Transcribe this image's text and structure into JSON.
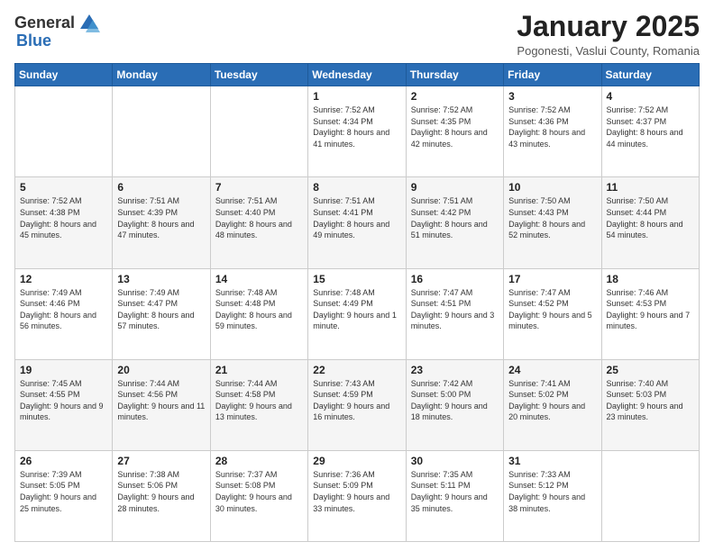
{
  "logo": {
    "general": "General",
    "blue": "Blue"
  },
  "header": {
    "title": "January 2025",
    "subtitle": "Pogonesti, Vaslui County, Romania"
  },
  "weekdays": [
    "Sunday",
    "Monday",
    "Tuesday",
    "Wednesday",
    "Thursday",
    "Friday",
    "Saturday"
  ],
  "weeks": [
    [
      {
        "day": "",
        "info": ""
      },
      {
        "day": "",
        "info": ""
      },
      {
        "day": "",
        "info": ""
      },
      {
        "day": "1",
        "info": "Sunrise: 7:52 AM\nSunset: 4:34 PM\nDaylight: 8 hours and 41 minutes."
      },
      {
        "day": "2",
        "info": "Sunrise: 7:52 AM\nSunset: 4:35 PM\nDaylight: 8 hours and 42 minutes."
      },
      {
        "day": "3",
        "info": "Sunrise: 7:52 AM\nSunset: 4:36 PM\nDaylight: 8 hours and 43 minutes."
      },
      {
        "day": "4",
        "info": "Sunrise: 7:52 AM\nSunset: 4:37 PM\nDaylight: 8 hours and 44 minutes."
      }
    ],
    [
      {
        "day": "5",
        "info": "Sunrise: 7:52 AM\nSunset: 4:38 PM\nDaylight: 8 hours and 45 minutes."
      },
      {
        "day": "6",
        "info": "Sunrise: 7:51 AM\nSunset: 4:39 PM\nDaylight: 8 hours and 47 minutes."
      },
      {
        "day": "7",
        "info": "Sunrise: 7:51 AM\nSunset: 4:40 PM\nDaylight: 8 hours and 48 minutes."
      },
      {
        "day": "8",
        "info": "Sunrise: 7:51 AM\nSunset: 4:41 PM\nDaylight: 8 hours and 49 minutes."
      },
      {
        "day": "9",
        "info": "Sunrise: 7:51 AM\nSunset: 4:42 PM\nDaylight: 8 hours and 51 minutes."
      },
      {
        "day": "10",
        "info": "Sunrise: 7:50 AM\nSunset: 4:43 PM\nDaylight: 8 hours and 52 minutes."
      },
      {
        "day": "11",
        "info": "Sunrise: 7:50 AM\nSunset: 4:44 PM\nDaylight: 8 hours and 54 minutes."
      }
    ],
    [
      {
        "day": "12",
        "info": "Sunrise: 7:49 AM\nSunset: 4:46 PM\nDaylight: 8 hours and 56 minutes."
      },
      {
        "day": "13",
        "info": "Sunrise: 7:49 AM\nSunset: 4:47 PM\nDaylight: 8 hours and 57 minutes."
      },
      {
        "day": "14",
        "info": "Sunrise: 7:48 AM\nSunset: 4:48 PM\nDaylight: 8 hours and 59 minutes."
      },
      {
        "day": "15",
        "info": "Sunrise: 7:48 AM\nSunset: 4:49 PM\nDaylight: 9 hours and 1 minute."
      },
      {
        "day": "16",
        "info": "Sunrise: 7:47 AM\nSunset: 4:51 PM\nDaylight: 9 hours and 3 minutes."
      },
      {
        "day": "17",
        "info": "Sunrise: 7:47 AM\nSunset: 4:52 PM\nDaylight: 9 hours and 5 minutes."
      },
      {
        "day": "18",
        "info": "Sunrise: 7:46 AM\nSunset: 4:53 PM\nDaylight: 9 hours and 7 minutes."
      }
    ],
    [
      {
        "day": "19",
        "info": "Sunrise: 7:45 AM\nSunset: 4:55 PM\nDaylight: 9 hours and 9 minutes."
      },
      {
        "day": "20",
        "info": "Sunrise: 7:44 AM\nSunset: 4:56 PM\nDaylight: 9 hours and 11 minutes."
      },
      {
        "day": "21",
        "info": "Sunrise: 7:44 AM\nSunset: 4:58 PM\nDaylight: 9 hours and 13 minutes."
      },
      {
        "day": "22",
        "info": "Sunrise: 7:43 AM\nSunset: 4:59 PM\nDaylight: 9 hours and 16 minutes."
      },
      {
        "day": "23",
        "info": "Sunrise: 7:42 AM\nSunset: 5:00 PM\nDaylight: 9 hours and 18 minutes."
      },
      {
        "day": "24",
        "info": "Sunrise: 7:41 AM\nSunset: 5:02 PM\nDaylight: 9 hours and 20 minutes."
      },
      {
        "day": "25",
        "info": "Sunrise: 7:40 AM\nSunset: 5:03 PM\nDaylight: 9 hours and 23 minutes."
      }
    ],
    [
      {
        "day": "26",
        "info": "Sunrise: 7:39 AM\nSunset: 5:05 PM\nDaylight: 9 hours and 25 minutes."
      },
      {
        "day": "27",
        "info": "Sunrise: 7:38 AM\nSunset: 5:06 PM\nDaylight: 9 hours and 28 minutes."
      },
      {
        "day": "28",
        "info": "Sunrise: 7:37 AM\nSunset: 5:08 PM\nDaylight: 9 hours and 30 minutes."
      },
      {
        "day": "29",
        "info": "Sunrise: 7:36 AM\nSunset: 5:09 PM\nDaylight: 9 hours and 33 minutes."
      },
      {
        "day": "30",
        "info": "Sunrise: 7:35 AM\nSunset: 5:11 PM\nDaylight: 9 hours and 35 minutes."
      },
      {
        "day": "31",
        "info": "Sunrise: 7:33 AM\nSunset: 5:12 PM\nDaylight: 9 hours and 38 minutes."
      },
      {
        "day": "",
        "info": ""
      }
    ]
  ]
}
